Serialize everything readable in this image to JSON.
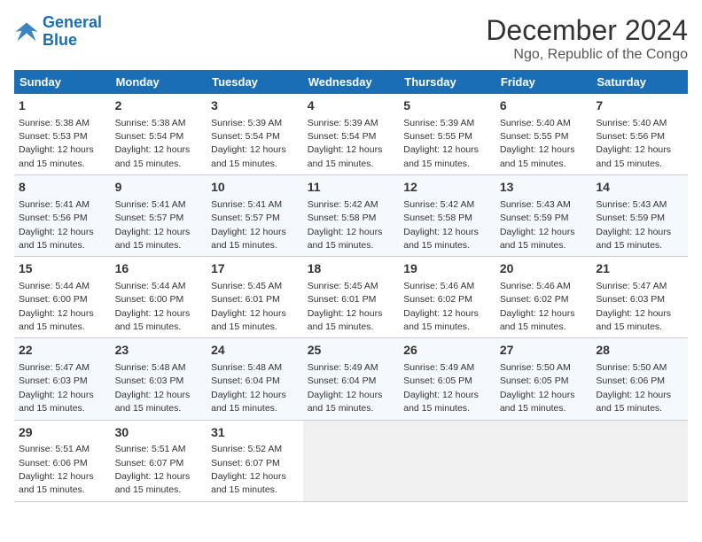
{
  "logo": {
    "line1": "General",
    "line2": "Blue"
  },
  "title": "December 2024",
  "subtitle": "Ngo, Republic of the Congo",
  "days_of_week": [
    "Sunday",
    "Monday",
    "Tuesday",
    "Wednesday",
    "Thursday",
    "Friday",
    "Saturday"
  ],
  "weeks": [
    [
      {
        "day": "1",
        "sunrise": "5:38 AM",
        "sunset": "5:53 PM",
        "daylight": "12 hours and 15 minutes."
      },
      {
        "day": "2",
        "sunrise": "5:38 AM",
        "sunset": "5:54 PM",
        "daylight": "12 hours and 15 minutes."
      },
      {
        "day": "3",
        "sunrise": "5:39 AM",
        "sunset": "5:54 PM",
        "daylight": "12 hours and 15 minutes."
      },
      {
        "day": "4",
        "sunrise": "5:39 AM",
        "sunset": "5:54 PM",
        "daylight": "12 hours and 15 minutes."
      },
      {
        "day": "5",
        "sunrise": "5:39 AM",
        "sunset": "5:55 PM",
        "daylight": "12 hours and 15 minutes."
      },
      {
        "day": "6",
        "sunrise": "5:40 AM",
        "sunset": "5:55 PM",
        "daylight": "12 hours and 15 minutes."
      },
      {
        "day": "7",
        "sunrise": "5:40 AM",
        "sunset": "5:56 PM",
        "daylight": "12 hours and 15 minutes."
      }
    ],
    [
      {
        "day": "8",
        "sunrise": "5:41 AM",
        "sunset": "5:56 PM",
        "daylight": "12 hours and 15 minutes."
      },
      {
        "day": "9",
        "sunrise": "5:41 AM",
        "sunset": "5:57 PM",
        "daylight": "12 hours and 15 minutes."
      },
      {
        "day": "10",
        "sunrise": "5:41 AM",
        "sunset": "5:57 PM",
        "daylight": "12 hours and 15 minutes."
      },
      {
        "day": "11",
        "sunrise": "5:42 AM",
        "sunset": "5:58 PM",
        "daylight": "12 hours and 15 minutes."
      },
      {
        "day": "12",
        "sunrise": "5:42 AM",
        "sunset": "5:58 PM",
        "daylight": "12 hours and 15 minutes."
      },
      {
        "day": "13",
        "sunrise": "5:43 AM",
        "sunset": "5:59 PM",
        "daylight": "12 hours and 15 minutes."
      },
      {
        "day": "14",
        "sunrise": "5:43 AM",
        "sunset": "5:59 PM",
        "daylight": "12 hours and 15 minutes."
      }
    ],
    [
      {
        "day": "15",
        "sunrise": "5:44 AM",
        "sunset": "6:00 PM",
        "daylight": "12 hours and 15 minutes."
      },
      {
        "day": "16",
        "sunrise": "5:44 AM",
        "sunset": "6:00 PM",
        "daylight": "12 hours and 15 minutes."
      },
      {
        "day": "17",
        "sunrise": "5:45 AM",
        "sunset": "6:01 PM",
        "daylight": "12 hours and 15 minutes."
      },
      {
        "day": "18",
        "sunrise": "5:45 AM",
        "sunset": "6:01 PM",
        "daylight": "12 hours and 15 minutes."
      },
      {
        "day": "19",
        "sunrise": "5:46 AM",
        "sunset": "6:02 PM",
        "daylight": "12 hours and 15 minutes."
      },
      {
        "day": "20",
        "sunrise": "5:46 AM",
        "sunset": "6:02 PM",
        "daylight": "12 hours and 15 minutes."
      },
      {
        "day": "21",
        "sunrise": "5:47 AM",
        "sunset": "6:03 PM",
        "daylight": "12 hours and 15 minutes."
      }
    ],
    [
      {
        "day": "22",
        "sunrise": "5:47 AM",
        "sunset": "6:03 PM",
        "daylight": "12 hours and 15 minutes."
      },
      {
        "day": "23",
        "sunrise": "5:48 AM",
        "sunset": "6:03 PM",
        "daylight": "12 hours and 15 minutes."
      },
      {
        "day": "24",
        "sunrise": "5:48 AM",
        "sunset": "6:04 PM",
        "daylight": "12 hours and 15 minutes."
      },
      {
        "day": "25",
        "sunrise": "5:49 AM",
        "sunset": "6:04 PM",
        "daylight": "12 hours and 15 minutes."
      },
      {
        "day": "26",
        "sunrise": "5:49 AM",
        "sunset": "6:05 PM",
        "daylight": "12 hours and 15 minutes."
      },
      {
        "day": "27",
        "sunrise": "5:50 AM",
        "sunset": "6:05 PM",
        "daylight": "12 hours and 15 minutes."
      },
      {
        "day": "28",
        "sunrise": "5:50 AM",
        "sunset": "6:06 PM",
        "daylight": "12 hours and 15 minutes."
      }
    ],
    [
      {
        "day": "29",
        "sunrise": "5:51 AM",
        "sunset": "6:06 PM",
        "daylight": "12 hours and 15 minutes."
      },
      {
        "day": "30",
        "sunrise": "5:51 AM",
        "sunset": "6:07 PM",
        "daylight": "12 hours and 15 minutes."
      },
      {
        "day": "31",
        "sunrise": "5:52 AM",
        "sunset": "6:07 PM",
        "daylight": "12 hours and 15 minutes."
      },
      null,
      null,
      null,
      null
    ]
  ]
}
